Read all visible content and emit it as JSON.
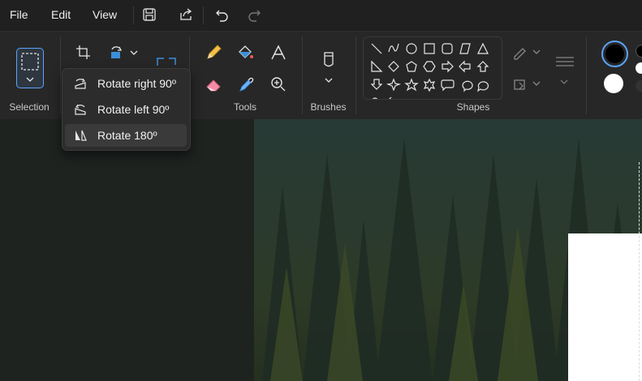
{
  "menubar": {
    "items": [
      {
        "label": "File"
      },
      {
        "label": "Edit"
      },
      {
        "label": "View"
      }
    ]
  },
  "ribbon": {
    "groups": {
      "selection": "Selection",
      "tools": "Tools",
      "brushes": "Brushes",
      "shapes": "Shapes"
    }
  },
  "rotate_menu": {
    "items": [
      {
        "label": "Rotate right 90º"
      },
      {
        "label": "Rotate left 90º"
      },
      {
        "label": "Rotate 180º"
      }
    ]
  },
  "colors": {
    "primary": "#000000",
    "secondary": "#ffffff",
    "accent": "#5aa5ff"
  }
}
